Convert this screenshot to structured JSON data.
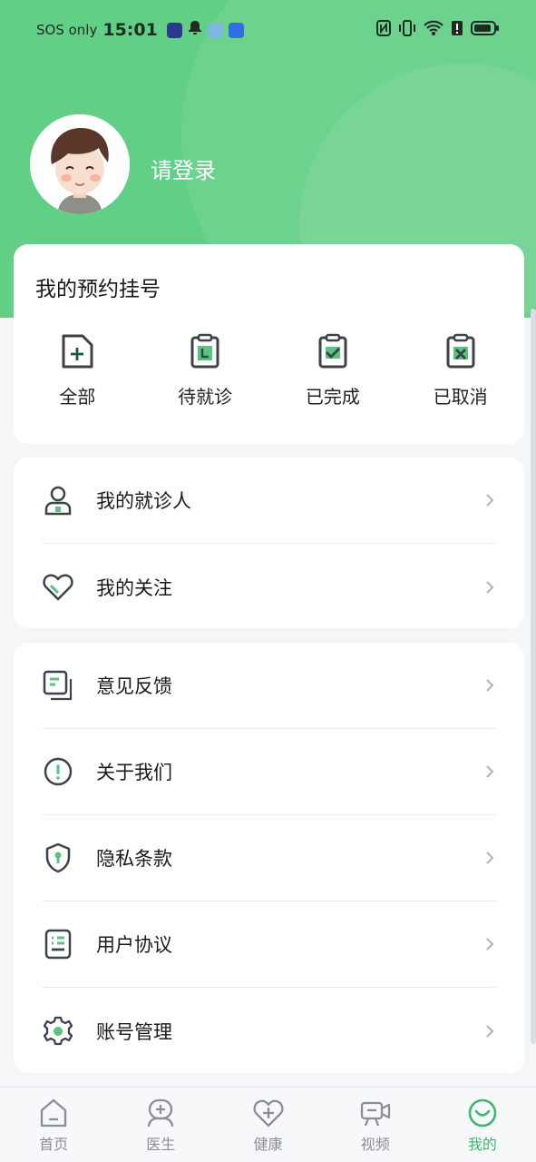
{
  "status_bar": {
    "carrier": "SOS only",
    "time": "15:01"
  },
  "profile": {
    "login_prompt": "请登录"
  },
  "appointments": {
    "title": "我的预约挂号",
    "items": [
      {
        "label": "全部",
        "icon": "clipboard-plus-icon"
      },
      {
        "label": "待就诊",
        "icon": "clipboard-clock-icon"
      },
      {
        "label": "已完成",
        "icon": "clipboard-check-icon"
      },
      {
        "label": "已取消",
        "icon": "clipboard-x-icon"
      }
    ]
  },
  "menu_group_1": [
    {
      "label": "我的就诊人",
      "icon": "person-icon"
    },
    {
      "label": "我的关注",
      "icon": "heart-icon"
    }
  ],
  "menu_group_2": [
    {
      "label": "意见反馈",
      "icon": "feedback-icon"
    },
    {
      "label": "关于我们",
      "icon": "info-icon"
    },
    {
      "label": "隐私条款",
      "icon": "shield-icon"
    },
    {
      "label": "用户协议",
      "icon": "document-icon"
    },
    {
      "label": "账号管理",
      "icon": "gear-icon"
    }
  ],
  "tabbar": [
    {
      "label": "首页",
      "icon": "home-icon",
      "active": false
    },
    {
      "label": "医生",
      "icon": "doctor-icon",
      "active": false
    },
    {
      "label": "健康",
      "icon": "health-icon",
      "active": false
    },
    {
      "label": "视频",
      "icon": "video-icon",
      "active": false
    },
    {
      "label": "我的",
      "icon": "profile-icon",
      "active": true
    }
  ],
  "colors": {
    "brand_green": "#62cf86",
    "active_tab": "#3bb86a",
    "icon_dark": "#3d4148"
  }
}
